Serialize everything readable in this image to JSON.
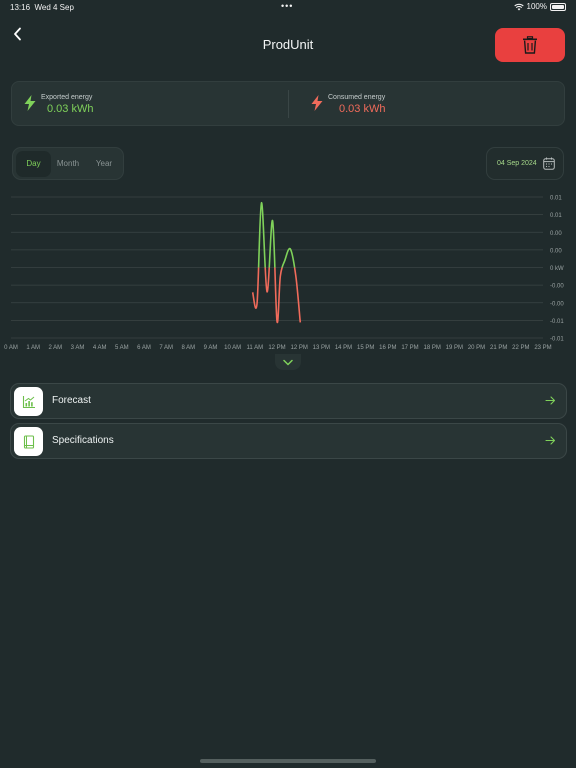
{
  "status_bar": {
    "time": "13:16",
    "date": "Wed 4 Sep",
    "battery": "100%",
    "battery_level": 1.0
  },
  "header": {
    "title": "ProdUnit",
    "back_icon": "chevron-left-icon",
    "delete_icon": "trash-icon"
  },
  "energy": {
    "exported": {
      "label": "Exported energy",
      "value": "0.03 kWh",
      "icon": "bolt-icon"
    },
    "consumed": {
      "label": "Consumed energy",
      "value": "0.03 kWh",
      "icon": "bolt-icon"
    }
  },
  "period": {
    "tabs": [
      "Day",
      "Month",
      "Year"
    ],
    "selected": "Day"
  },
  "date_picker": {
    "value": "04 Sep 2024",
    "icon": "calendar-icon"
  },
  "chart_data": {
    "type": "line",
    "x_ticks": [
      "0 AM",
      "1 AM",
      "2 AM",
      "3 AM",
      "4 AM",
      "5 AM",
      "6 AM",
      "7 AM",
      "8 AM",
      "9 AM",
      "10 AM",
      "11 AM",
      "12 PM",
      "12 PM",
      "13 PM",
      "14 PM",
      "15 PM",
      "16 PM",
      "17 PM",
      "18 PM",
      "19 PM",
      "20 PM",
      "21 PM",
      "22 PM",
      "23 PM"
    ],
    "y_ticks": [
      "0.01",
      "0.01",
      "0.00",
      "0.00",
      "0 kW",
      "-0.00",
      "-0.00",
      "-0.01",
      "-0.01"
    ],
    "ylim": [
      -0.0122,
      0.0122
    ],
    "grid": true,
    "colors": {
      "positive": "#7fd15a",
      "negative": "#f06b5b",
      "grid": "#3a4545"
    },
    "series": [
      {
        "x": [
          10.9,
          11.1,
          11.3,
          11.55,
          11.8,
          12.0,
          12.15,
          12.35,
          12.6,
          12.85,
          13.05
        ],
        "values": [
          -0.0043,
          -0.0062,
          0.0112,
          -0.0042,
          0.0081,
          -0.0093,
          -0.0015,
          0.0012,
          0.0032,
          -0.0015,
          -0.0095
        ]
      }
    ]
  },
  "collapse": {
    "icon": "chevron-down-icon"
  },
  "nav": [
    {
      "label": "Forecast",
      "icon": "chart-icon",
      "arrow_icon": "arrow-right-icon"
    },
    {
      "label": "Specifications",
      "icon": "book-icon",
      "arrow_icon": "arrow-right-icon"
    }
  ]
}
